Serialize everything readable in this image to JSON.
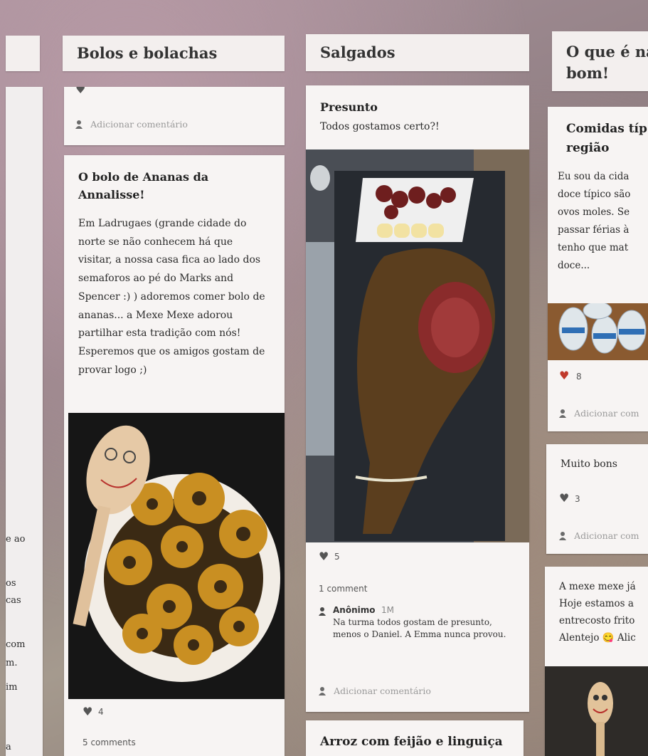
{
  "columns": [
    {
      "header": "Bolos e bolachas",
      "comment_stub": {
        "add_label": "Adicionar comentário"
      },
      "post": {
        "title": "O bolo de Ananas da Annalisse!",
        "body": "Em Ladrugaes (grande cidade do norte se não conhecem há que visitar, a nossa casa fica ao lado dos semaforos ao pé do Marks and Spencer :) ) adoremos comer bolo de ananas... a Mexe Mexe adorou partilhar esta tradição com nós! Esperemos que os amigos gostam de provar logo ;)",
        "likes": "4",
        "comments": "5 comments"
      }
    },
    {
      "header": "Salgados",
      "post": {
        "title": "Presunto",
        "body": "Todos gostamos certo?!",
        "likes": "5",
        "comments": "1 comment",
        "comment": {
          "author": "Anônimo",
          "time": "1M",
          "text": "Na turma todos gostam de presunto, menos o Daniel. A Emma nunca provou."
        },
        "add_label": "Adicionar comentário"
      },
      "post2": {
        "title": "Arroz com feijão e linguiça"
      }
    },
    {
      "header": "O que é na\nbom!",
      "post": {
        "title": "Comidas típ\nregião",
        "body": "Eu sou da cida doce típico são ovos moles. Se passar férias à tenho que mat doce...",
        "likes": "8",
        "add_label": "Adicionar com"
      },
      "post2": {
        "body": "Muito bons",
        "likes": "3",
        "add_label": "Adicionar com"
      },
      "post3": {
        "body": "A mexe mexe já Hoje estamos a entrecosto frito Alentejo 😋 Alic"
      }
    }
  ],
  "left_partial": {
    "fragments": [
      "e ao",
      "os",
      "cas",
      "com",
      "m.",
      "im",
      "a"
    ]
  }
}
